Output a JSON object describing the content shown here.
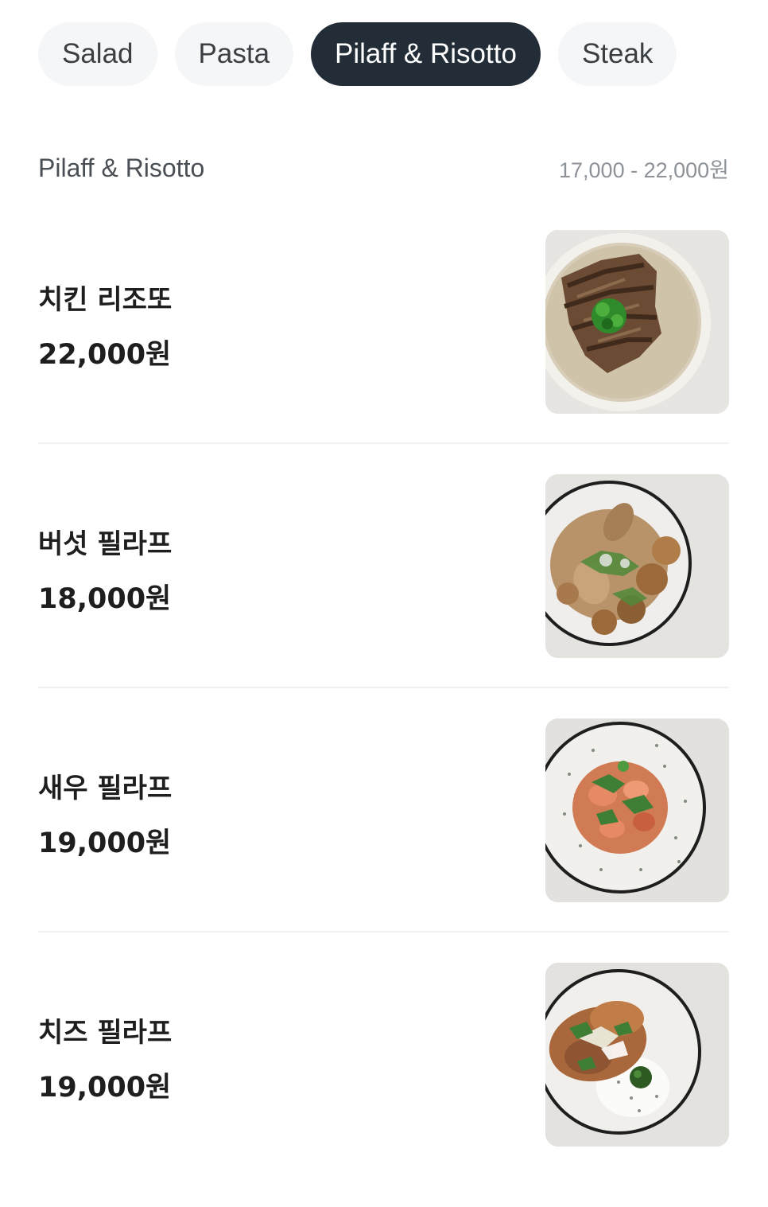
{
  "tabs": [
    {
      "label": "Salad",
      "active": false
    },
    {
      "label": "Pasta",
      "active": false
    },
    {
      "label": "Pilaff & Risotto",
      "active": true
    },
    {
      "label": "Steak",
      "active": false
    }
  ],
  "section": {
    "title": "Pilaff & Risotto",
    "price_range": "17,000 - 22,000원"
  },
  "items": [
    {
      "name": "치킨 리조또",
      "price": "22,000원",
      "photo": "chicken-risotto-photo"
    },
    {
      "name": "버섯 필라프",
      "price": "18,000원",
      "photo": "mushroom-pilaff-photo"
    },
    {
      "name": "새우 필라프",
      "price": "19,000원",
      "photo": "shrimp-pilaff-photo"
    },
    {
      "name": "치즈 필라프",
      "price": "19,000원",
      "photo": "cheese-pilaff-photo"
    }
  ],
  "colors": {
    "active_chip": "#232d37",
    "chip_bg": "#f5f6f7",
    "divider": "#eff0f2"
  }
}
